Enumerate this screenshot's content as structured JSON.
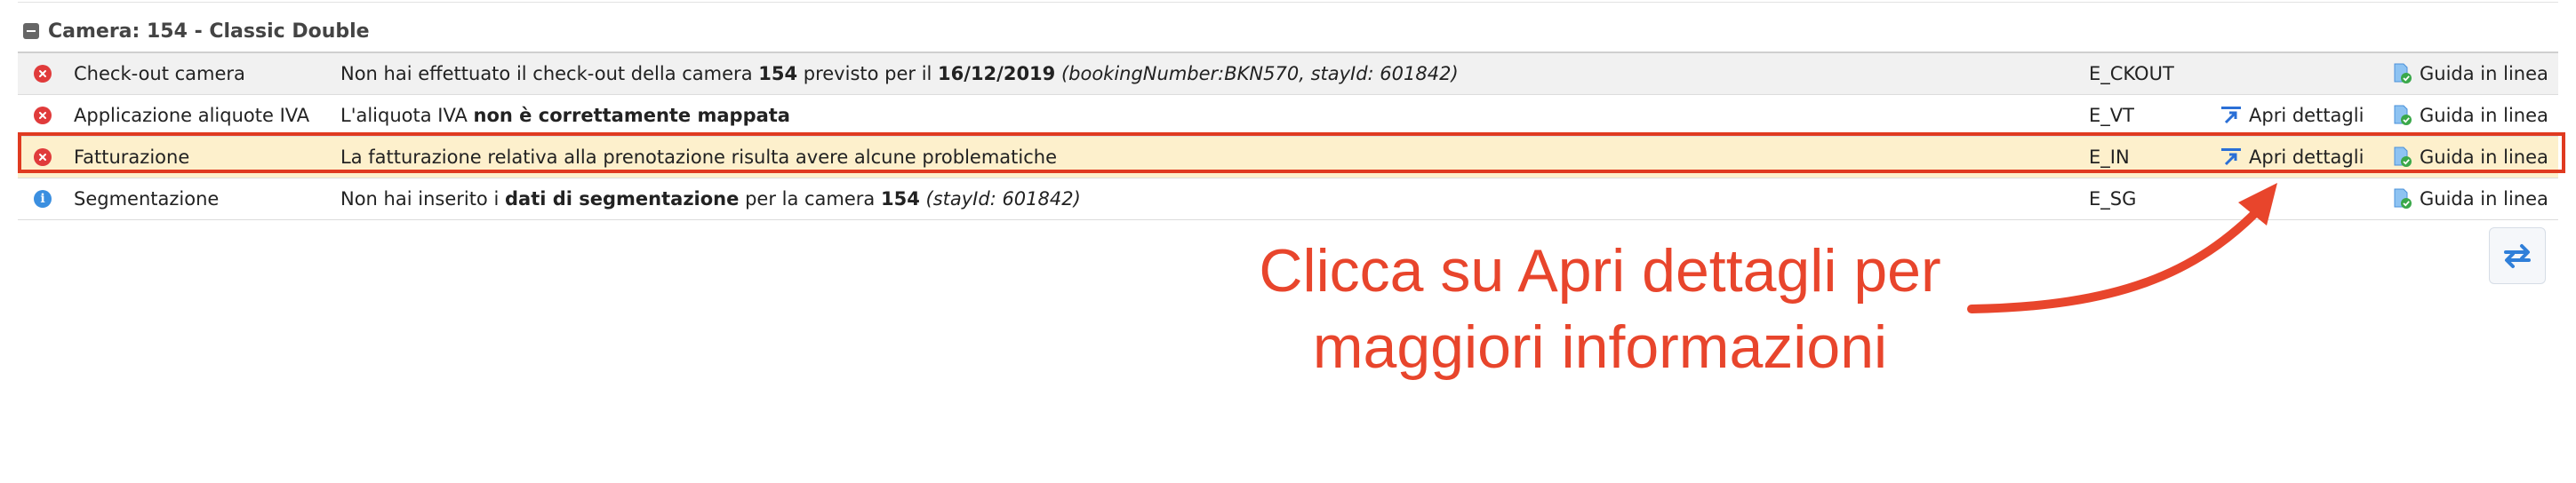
{
  "group": {
    "title": "Camera: 154 - Classic Double"
  },
  "rows": [
    {
      "type": "error",
      "title": "Check-out camera",
      "message": [
        {
          "text": "Non hai effettuato il check-out della camera ",
          "style": "normal"
        },
        {
          "text": "154",
          "style": "bold"
        },
        {
          "text": " previsto per il ",
          "style": "normal"
        },
        {
          "text": "16/12/2019",
          "style": "bold"
        },
        {
          "text": " (bookingNumber:BKN570, stayId: 601842)",
          "style": "italic"
        }
      ],
      "code": "E_CKOUT",
      "details_label": "",
      "guide_label": "Guida in linea"
    },
    {
      "type": "error",
      "title": "Applicazione aliquote IVA",
      "message": [
        {
          "text": "L'aliquota IVA ",
          "style": "normal"
        },
        {
          "text": "non è correttamente mappata",
          "style": "bold"
        }
      ],
      "code": "E_VT",
      "details_label": "Apri dettagli",
      "guide_label": "Guida in linea"
    },
    {
      "type": "error",
      "title": "Fatturazione",
      "message": [
        {
          "text": "La fatturazione relativa alla prenotazione risulta avere alcune problematiche",
          "style": "normal"
        }
      ],
      "code": "E_IN",
      "details_label": "Apri dettagli",
      "guide_label": "Guida in linea",
      "highlighted": true
    },
    {
      "type": "info",
      "title": "Segmentazione",
      "message": [
        {
          "text": "Non hai inserito i ",
          "style": "normal"
        },
        {
          "text": "dati di segmentazione",
          "style": "bold"
        },
        {
          "text": " per la camera ",
          "style": "normal"
        },
        {
          "text": "154",
          "style": "bold"
        },
        {
          "text": " (stayId: 601842)",
          "style": "italic"
        }
      ],
      "code": "E_SG",
      "details_label": "",
      "guide_label": "Guida in linea"
    }
  ],
  "annotation": {
    "line1": "Clicca su Apri dettagli per",
    "line2": "maggiori informazioni",
    "color": "#e8452c"
  },
  "icons": {
    "error": "error-circle-icon",
    "info": "info-circle-icon",
    "details": "open-details-icon",
    "guide": "online-guide-doc-icon",
    "refresh": "refresh-arrows-icon",
    "collapse": "collapse-minus-icon"
  },
  "colors": {
    "error": "#e03b3b",
    "info": "#3b8fe0",
    "highlight_row": "#fdf0cc",
    "outline": "#e03a20",
    "link_blue": "#2a6fd6"
  }
}
